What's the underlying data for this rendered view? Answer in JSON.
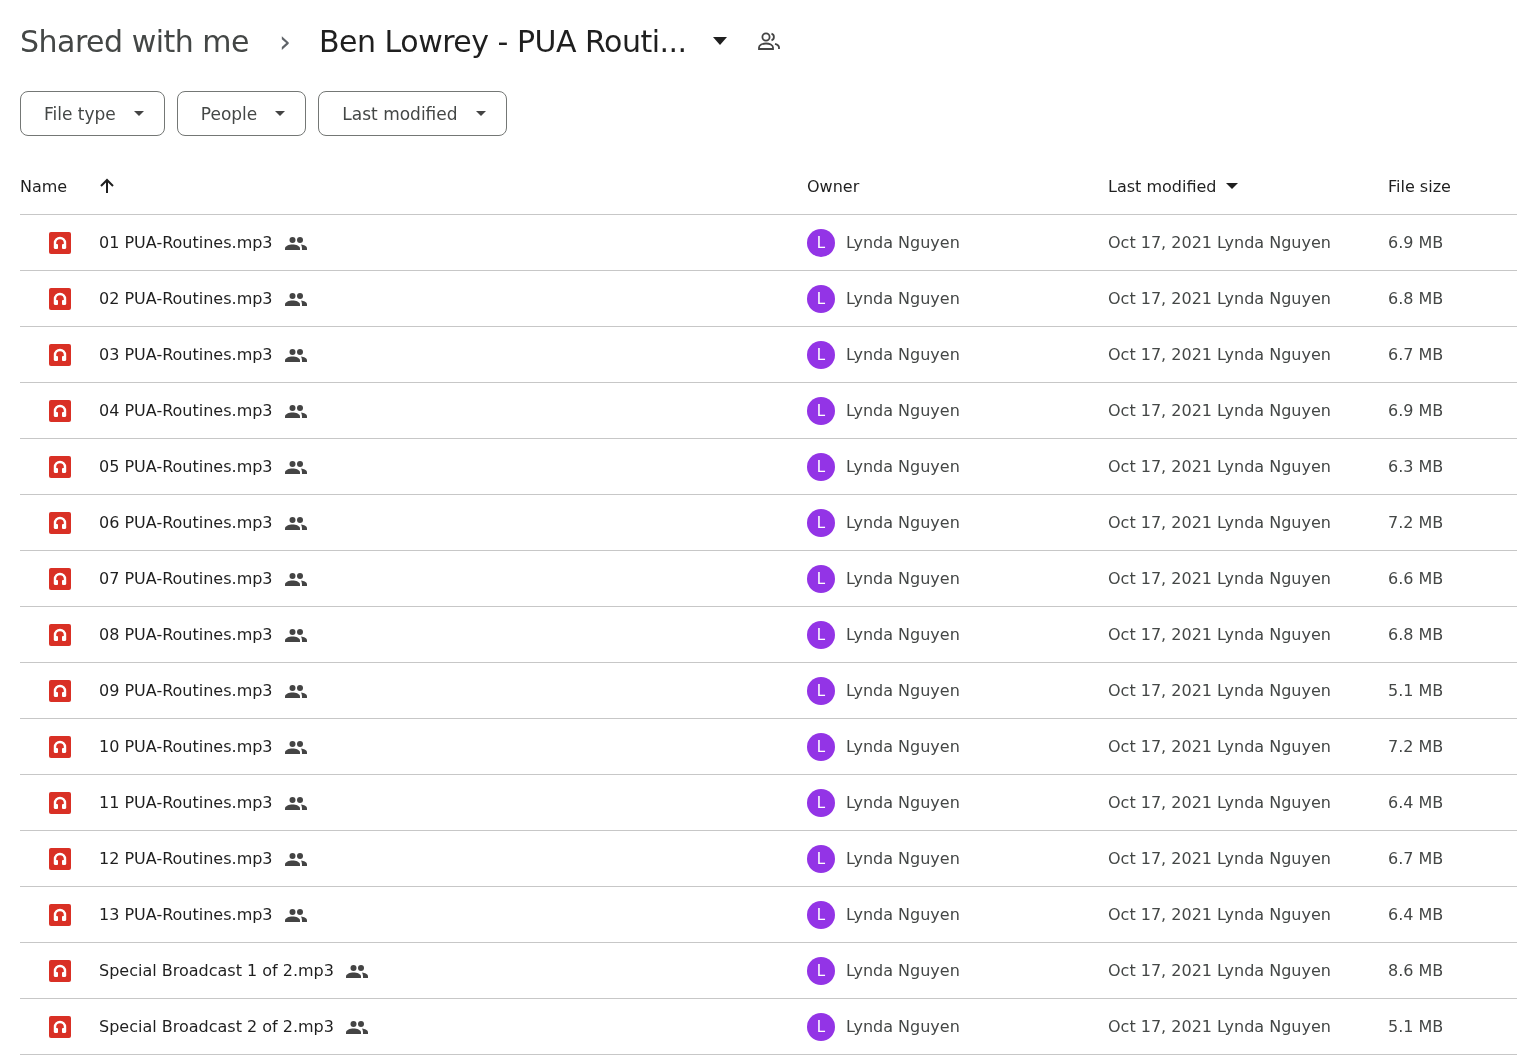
{
  "breadcrumb": {
    "parent": "Shared with me",
    "separator": "›",
    "current": "Ben Lowrey - PUA Routi..."
  },
  "filters": [
    {
      "label": "File type"
    },
    {
      "label": "People"
    },
    {
      "label": "Last modified"
    }
  ],
  "table": {
    "columns": [
      {
        "label": "Name",
        "sorted": true,
        "descending": false
      },
      {
        "label": "Owner",
        "sorted": false
      },
      {
        "label": "Last modified",
        "sorted": true,
        "descending": true
      },
      {
        "label": "File size",
        "sorted": false
      }
    ],
    "rows": [
      {
        "name": "01 PUA-Routines.mp3",
        "shared": true,
        "avatar": "L",
        "owner": "Lynda Nguyen",
        "modified": "Oct 17, 2021 Lynda Nguyen",
        "size": "6.9 MB"
      },
      {
        "name": "02 PUA-Routines.mp3",
        "shared": true,
        "avatar": "L",
        "owner": "Lynda Nguyen",
        "modified": "Oct 17, 2021 Lynda Nguyen",
        "size": "6.8 MB"
      },
      {
        "name": "03 PUA-Routines.mp3",
        "shared": true,
        "avatar": "L",
        "owner": "Lynda Nguyen",
        "modified": "Oct 17, 2021 Lynda Nguyen",
        "size": "6.7 MB"
      },
      {
        "name": "04 PUA-Routines.mp3",
        "shared": true,
        "avatar": "L",
        "owner": "Lynda Nguyen",
        "modified": "Oct 17, 2021 Lynda Nguyen",
        "size": "6.9 MB"
      },
      {
        "name": "05 PUA-Routines.mp3",
        "shared": true,
        "avatar": "L",
        "owner": "Lynda Nguyen",
        "modified": "Oct 17, 2021 Lynda Nguyen",
        "size": "6.3 MB"
      },
      {
        "name": "06 PUA-Routines.mp3",
        "shared": true,
        "avatar": "L",
        "owner": "Lynda Nguyen",
        "modified": "Oct 17, 2021 Lynda Nguyen",
        "size": "7.2 MB"
      },
      {
        "name": "07 PUA-Routines.mp3",
        "shared": true,
        "avatar": "L",
        "owner": "Lynda Nguyen",
        "modified": "Oct 17, 2021 Lynda Nguyen",
        "size": "6.6 MB"
      },
      {
        "name": "08 PUA-Routines.mp3",
        "shared": true,
        "avatar": "L",
        "owner": "Lynda Nguyen",
        "modified": "Oct 17, 2021 Lynda Nguyen",
        "size": "6.8 MB"
      },
      {
        "name": "09 PUA-Routines.mp3",
        "shared": true,
        "avatar": "L",
        "owner": "Lynda Nguyen",
        "modified": "Oct 17, 2021 Lynda Nguyen",
        "size": "5.1 MB"
      },
      {
        "name": "10 PUA-Routines.mp3",
        "shared": true,
        "avatar": "L",
        "owner": "Lynda Nguyen",
        "modified": "Oct 17, 2021 Lynda Nguyen",
        "size": "7.2 MB"
      },
      {
        "name": "11 PUA-Routines.mp3",
        "shared": true,
        "avatar": "L",
        "owner": "Lynda Nguyen",
        "modified": "Oct 17, 2021 Lynda Nguyen",
        "size": "6.4 MB"
      },
      {
        "name": "12 PUA-Routines.mp3",
        "shared": true,
        "avatar": "L",
        "owner": "Lynda Nguyen",
        "modified": "Oct 17, 2021 Lynda Nguyen",
        "size": "6.7 MB"
      },
      {
        "name": "13 PUA-Routines.mp3",
        "shared": true,
        "avatar": "L",
        "owner": "Lynda Nguyen",
        "modified": "Oct 17, 2021 Lynda Nguyen",
        "size": "6.4 MB"
      },
      {
        "name": "Special Broadcast 1 of 2.mp3",
        "shared": true,
        "avatar": "L",
        "owner": "Lynda Nguyen",
        "modified": "Oct 17, 2021 Lynda Nguyen",
        "size": "8.6 MB"
      },
      {
        "name": "Special Broadcast 2 of 2.mp3",
        "shared": true,
        "avatar": "L",
        "owner": "Lynda Nguyen",
        "modified": "Oct 17, 2021 Lynda Nguyen",
        "size": "5.1 MB"
      }
    ]
  }
}
